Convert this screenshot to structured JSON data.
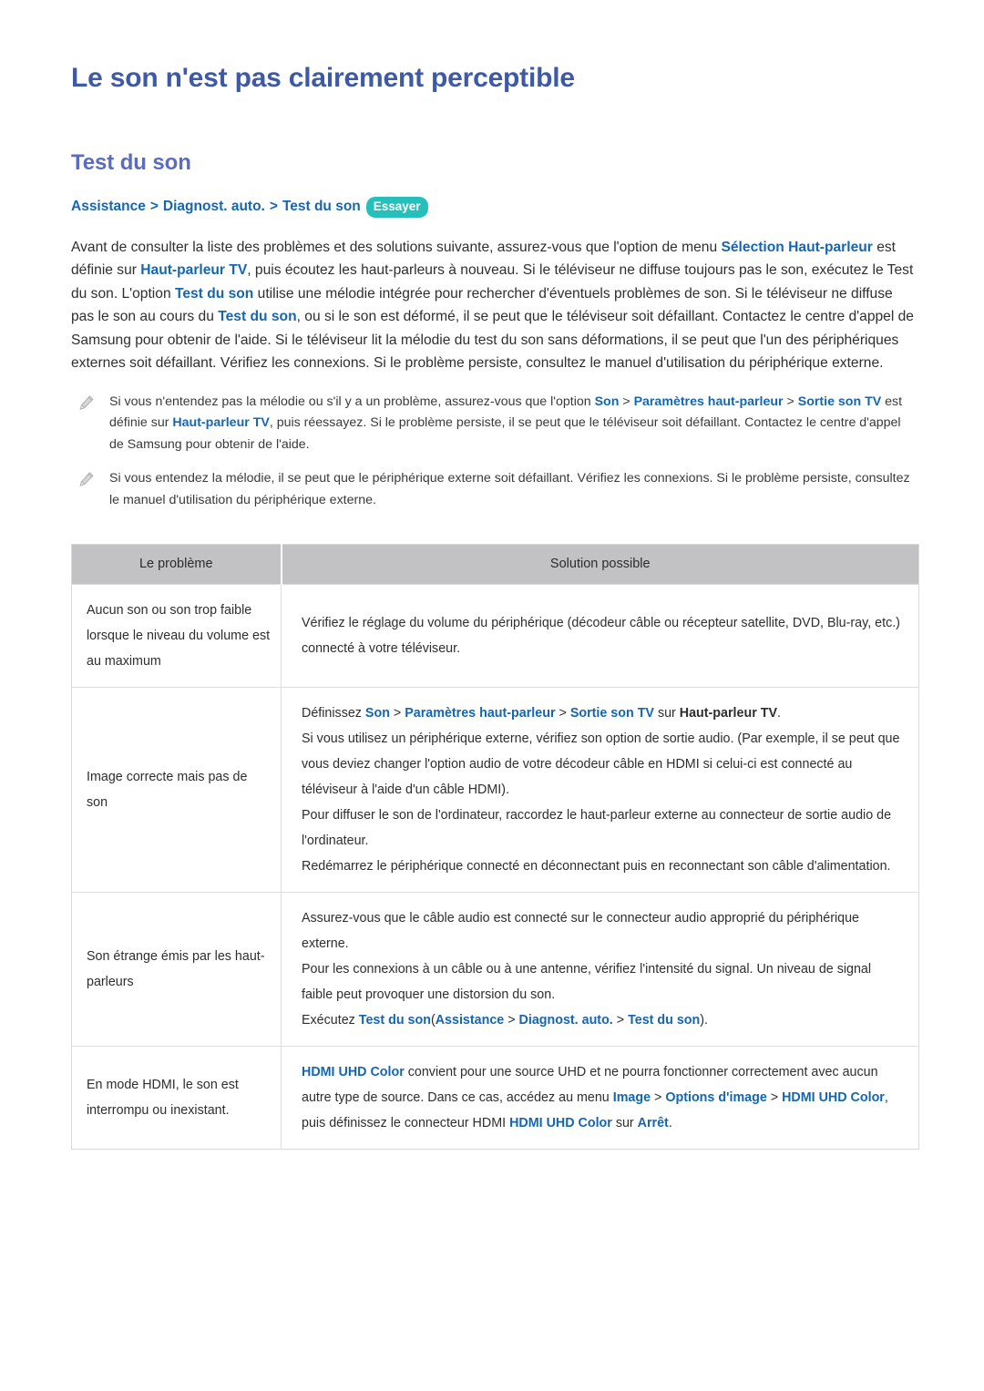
{
  "page": {
    "title": "Le son n'est pas clairement perceptible",
    "section_title": "Test du son"
  },
  "colors": {
    "h1": "#3e5aa6",
    "h2": "#5c6cc0",
    "keyword_blue": "#1566b2",
    "badge_teal": "#27bfbc",
    "table_header_bg": "#c2c2c4",
    "table_border": "#dedee2",
    "body_text": "#2e2e2e"
  },
  "breadcrumb": {
    "crumb1": "Assistance",
    "sep1": ">",
    "crumb2": "Diagnost. auto.",
    "sep2": ">",
    "crumb3": "Test du son",
    "badge": "Essayer"
  },
  "intro": {
    "p1": "Avant de consulter la liste des problèmes et des solutions suivante, assurez-vous que l'option de menu ",
    "kw1": "Sélection Haut-parleur",
    "p2": " est définie sur ",
    "kw2": "Haut-parleur TV",
    "p3": ", puis écoutez les haut-parleurs à nouveau. Si le téléviseur ne diffuse toujours pas le son, exécutez le Test du son. L'option ",
    "kw3": "Test du son",
    "p4": " utilise une mélodie intégrée pour rechercher d'éventuels problèmes de son. Si le téléviseur ne diffuse pas le son au cours du ",
    "kw4": "Test du son",
    "p5": ", ou si le son est déformé, il se peut que le téléviseur soit défaillant. Contactez le centre d'appel de Samsung pour obtenir de l'aide. Si le téléviseur lit la mélodie du test du son sans déformations, il se peut que l'un des périphériques externes soit défaillant. Vérifiez les connexions. Si le problème persiste, consultez le manuel d'utilisation du périphérique externe."
  },
  "notes": [
    {
      "icon": "pencil-icon",
      "t1": "Si vous n'entendez pas la mélodie ou s'il y a un problème, assurez-vous que l'option ",
      "kw1": "Son",
      "s1": " > ",
      "kw2": "Paramètres haut-parleur",
      "s2": " > ",
      "kw3": "Sortie son TV",
      "t2": " est définie sur ",
      "kw4": "Haut-parleur TV",
      "t3": ", puis réessayez. Si le problème persiste, il se peut que le téléviseur soit défaillant. Contactez le centre d'appel de Samsung pour obtenir de l'aide."
    },
    {
      "icon": "pencil-icon",
      "t1": "Si vous entendez la mélodie, il se peut que le périphérique externe soit défaillant. Vérifiez les connexions. Si le problème persiste, consultez le manuel d'utilisation du périphérique externe."
    }
  ],
  "table": {
    "headers": {
      "col1": "Le problème",
      "col2": "Solution possible"
    },
    "rows": [
      {
        "problem": "Aucun son ou son trop faible lorsque le niveau du volume est au maximum",
        "solution_lines": [
          "Vérifiez le réglage du volume du périphérique (décodeur câble ou récepteur satellite, DVD, Blu-ray, etc.) connecté à votre téléviseur."
        ]
      },
      {
        "problem": "Image correcte mais pas de son",
        "solution_rich": {
          "l1_pre": "Définissez ",
          "l1_kw1": "Son",
          "l1_s1": " > ",
          "l1_kw2": "Paramètres haut-parleur",
          "l1_s2": " > ",
          "l1_kw3": "Sortie son TV",
          "l1_mid": " sur ",
          "l1_kw4": "Haut-parleur TV",
          "l1_end": ".",
          "l2": "Si vous utilisez un périphérique externe, vérifiez son option de sortie audio. (Par exemple, il se peut que vous deviez changer l'option audio de votre décodeur câble en HDMI si celui-ci est connecté au téléviseur à l'aide d'un câble HDMI).",
          "l3": "Pour diffuser le son de l'ordinateur, raccordez le haut-parleur externe au connecteur de sortie audio de l'ordinateur.",
          "l4": "Redémarrez le périphérique connecté en déconnectant puis en reconnectant son câble d'alimentation."
        }
      },
      {
        "problem": "Son étrange émis par les haut-parleurs",
        "solution_rich": {
          "l1": "Assurez-vous que le câble audio est connecté sur le connecteur audio approprié du périphérique externe.",
          "l2": "Pour les connexions à un câble ou à une antenne, vérifiez l'intensité du signal. Un niveau de signal faible peut provoquer une distorsion du son.",
          "l3_pre": "Exécutez ",
          "l3_kw1": "Test du son",
          "l3_paren_open": "(",
          "l3_kw2": "Assistance",
          "l3_s1": " > ",
          "l3_kw3": "Diagnost. auto.",
          "l3_s2": " > ",
          "l3_kw4": "Test du son",
          "l3_paren_close": ")."
        }
      },
      {
        "problem": "En mode HDMI, le son est interrompu ou inexistant.",
        "solution_rich": {
          "l1_kw1": "HDMI UHD Color",
          "l1_t1": " convient pour une source UHD et ne pourra fonctionner correctement avec aucun autre type de source. Dans ce cas, accédez au menu ",
          "l1_kw2": "Image",
          "l1_s1": " > ",
          "l1_kw3": "Options d'image",
          "l1_s2": " > ",
          "l1_kw4": "HDMI UHD Color",
          "l1_t2": ", puis définissez le connecteur HDMI ",
          "l1_kw5": "HDMI UHD Color",
          "l1_t3": " sur ",
          "l1_kw6": "Arrêt",
          "l1_t4": "."
        }
      }
    ]
  }
}
